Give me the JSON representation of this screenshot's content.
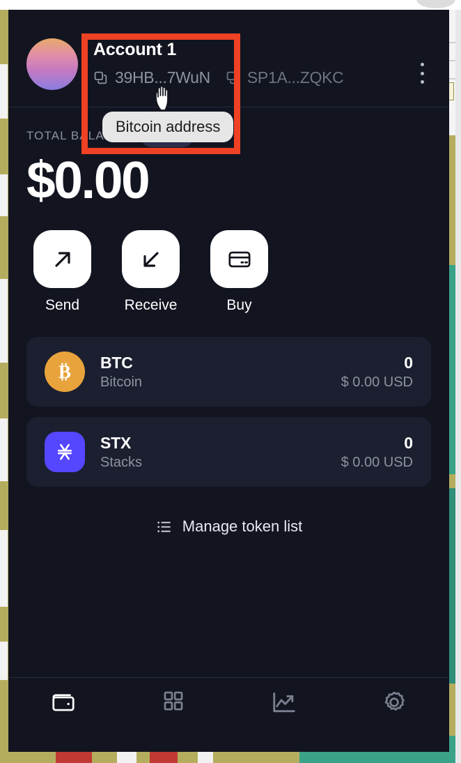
{
  "window": {
    "app_name": "wallet-extension-popup"
  },
  "header": {
    "account_name": "Account 1",
    "avatar": "gradient-avatar",
    "addresses": [
      {
        "id": "bitcoin",
        "label": "39HB...7WuN",
        "icon": "copy-icon",
        "dimmed": false
      },
      {
        "id": "stacks",
        "label": "SP1A...ZQKC",
        "icon": "copy-icon",
        "dimmed": true
      }
    ],
    "menu_icon": "kebab-menu-icon"
  },
  "tooltip": {
    "text": "Bitcoin address"
  },
  "balance": {
    "label": "TOTAL BALANCE",
    "currency_badge": "USD",
    "amount": "$0.00"
  },
  "actions": [
    {
      "id": "send",
      "label": "Send",
      "icon": "arrow-up-right-icon"
    },
    {
      "id": "receive",
      "label": "Receive",
      "icon": "arrow-down-left-icon"
    },
    {
      "id": "buy",
      "label": "Buy",
      "icon": "credit-card-icon"
    }
  ],
  "tokens": [
    {
      "symbol": "BTC",
      "name": "Bitcoin",
      "amount": "0",
      "fiat": "$ 0.00 USD",
      "icon": "bitcoin-icon",
      "icon_color": "#e8a33d"
    },
    {
      "symbol": "STX",
      "name": "Stacks",
      "amount": "0",
      "fiat": "$ 0.00 USD",
      "icon": "stacks-icon",
      "icon_color": "#5546ff"
    }
  ],
  "manage_tokens": {
    "label": "Manage token list",
    "icon": "list-icon"
  },
  "bottom_nav": [
    {
      "id": "wallet",
      "icon": "wallet-icon",
      "active": true
    },
    {
      "id": "apps",
      "icon": "grid-apps-icon",
      "active": false
    },
    {
      "id": "activity",
      "icon": "chart-trend-icon",
      "active": false
    },
    {
      "id": "settings",
      "icon": "gear-icon",
      "active": false
    }
  ],
  "annotation": {
    "type": "highlight-rectangle",
    "color": "#ef4123"
  },
  "colors": {
    "popup_background": "#121520",
    "card_background": "#1b1f30",
    "text_primary": "#ffffff",
    "text_muted": "#8d93a1",
    "badge_background": "#2b2f49",
    "divider": "#262a45",
    "annotation": "#ef4123",
    "tooltip_background": "#e6e6e6"
  }
}
